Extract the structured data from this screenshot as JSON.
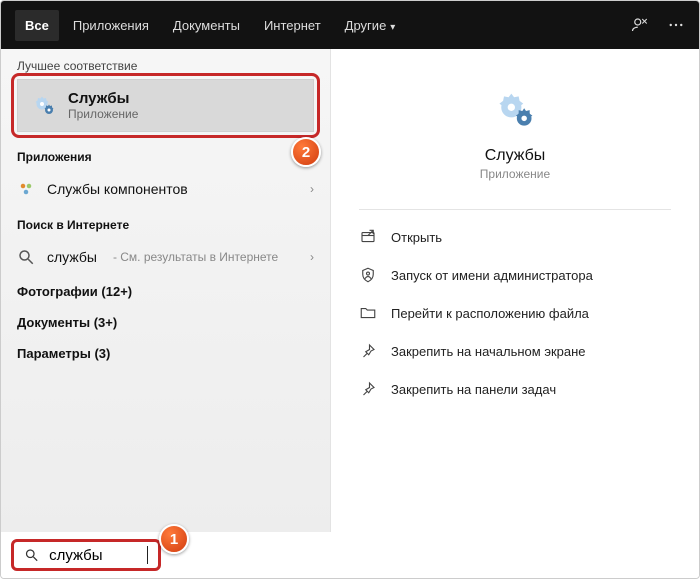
{
  "topbar": {
    "tabs": [
      {
        "label": "Все"
      },
      {
        "label": "Приложения"
      },
      {
        "label": "Документы"
      },
      {
        "label": "Интернет"
      },
      {
        "label": "Другие"
      }
    ]
  },
  "left": {
    "best_match_header": "Лучшее соответствие",
    "best_match": {
      "title": "Службы",
      "subtitle": "Приложение"
    },
    "apps_header": "Приложения",
    "apps_row": {
      "title": "Службы компонентов"
    },
    "web_header": "Поиск в Интернете",
    "web_row": {
      "query": "службы",
      "suffix": " - См. результаты в Интернете"
    },
    "photos": "Фотографии (12+)",
    "documents": "Документы (3+)",
    "settings": "Параметры (3)"
  },
  "detail": {
    "title": "Службы",
    "subtitle": "Приложение",
    "actions": {
      "open": "Открыть",
      "run_admin": "Запуск от имени администратора",
      "open_location": "Перейти к расположению файла",
      "pin_start": "Закрепить на начальном экране",
      "pin_taskbar": "Закрепить на панели задач"
    }
  },
  "search": {
    "value": "службы"
  },
  "callouts": {
    "one": "1",
    "two": "2"
  }
}
